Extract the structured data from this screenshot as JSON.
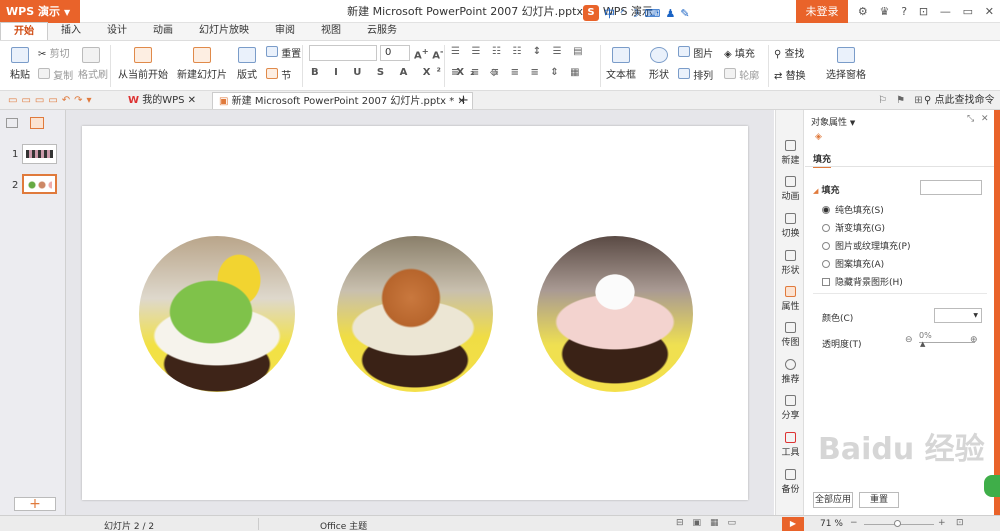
{
  "app": {
    "name": "WPS 演示",
    "title": "新建 Microsoft PowerPoint 2007 幻灯片.pptx * - WPS 演示",
    "login": "未登录"
  },
  "tabs": [
    "开始",
    "插入",
    "设计",
    "动画",
    "幻灯片放映",
    "审阅",
    "视图",
    "云服务"
  ],
  "ribbon": {
    "paste": "粘贴",
    "cut": "剪切",
    "copy": "复制",
    "format_painter": "格式刷",
    "from_current": "从当前开始",
    "new_slide": "新建幻灯片",
    "layout": "版式",
    "reset": "重置",
    "section": "节",
    "font_size": "0",
    "textbox": "文本框",
    "shape": "形状",
    "picture": "图片",
    "arrange": "排列",
    "fill": "填充",
    "outline": "轮廓",
    "find": "查找",
    "replace": "替换",
    "select_pane": "选择窗格"
  },
  "doc_tabs": {
    "mywps": "我的WPS",
    "file": "新建 Microsoft PowerPoint 2007 幻灯片.pptx *",
    "search": "点此查找命令"
  },
  "slides": [
    "1",
    "2"
  ],
  "side_bar": [
    "新建",
    "动画",
    "切换",
    "形状",
    "属性",
    "传图",
    "推荐",
    "分享",
    "工具",
    "备份"
  ],
  "props": {
    "header": "对象属性",
    "tab": "填充",
    "section": "填充",
    "options": [
      "纯色填充(S)",
      "渐变填充(G)",
      "图片或纹理填充(P)",
      "图案填充(A)"
    ],
    "hide_bg": "隐藏背景图形(H)",
    "color_label": "颜色(C)",
    "transparency_label": "透明度(T)",
    "transparency_value": "0%",
    "apply_all": "全部应用",
    "reset": "重置"
  },
  "status": {
    "slide": "幻灯片 2 / 2",
    "theme": "Office 主题",
    "zoom": "71 %"
  },
  "watermark": "Baidu 经验",
  "colors": {
    "accent": "#e9632a",
    "slide_yellow": "#f4e04a"
  }
}
